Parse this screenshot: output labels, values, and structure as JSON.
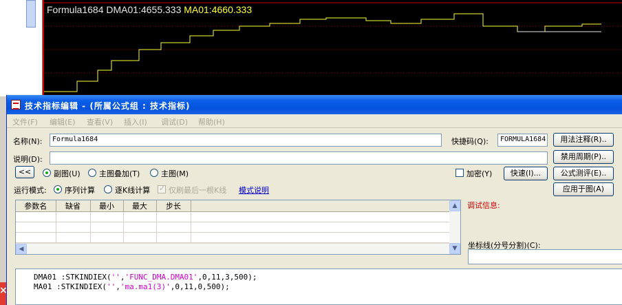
{
  "chart": {
    "label_formula": "Formula1684",
    "label_dma": "DMA01:4655.333",
    "label_ma": "MA01:4660.333",
    "colors": {
      "background": "#000000",
      "frame": "#cc0000",
      "ma_line": "#ffff33",
      "dma_line": "#e6e6e6"
    }
  },
  "window": {
    "title": "技术指标编辑 - (所属公式组 : 技术指标)",
    "menu": [
      "文件(F)",
      "编辑(E)",
      "查看(V)",
      "插入(I)",
      "调试(D)",
      "帮助(H)"
    ]
  },
  "form": {
    "name_label": "名称(N):",
    "name_value": "Formula1684",
    "shortcut_label": "快捷码(Q):",
    "shortcut_value": "FORMULA1684",
    "desc_label": "说明(D):",
    "desc_value": "",
    "collapse_button": "<<",
    "display_options": [
      "副图(U)",
      "主图叠加(T)",
      "主图(M)"
    ],
    "display_selected": "副图(U)",
    "encrypt_label": "加密(Y)",
    "fast_button": "快速(I)...",
    "mode_label": "运行模式:",
    "mode_options": [
      "序列计算",
      "逐K线计算"
    ],
    "mode_selected": "序列计算",
    "refresh_last_label": "仅刷最后一根K线",
    "mode_help_link": "模式说明"
  },
  "buttons": {
    "usage": "用法注释(R)..",
    "disabled_period": "禁用周期(P)..",
    "formula_eval": "公式测评(E)..",
    "apply_to_chart": "应用于图(A)"
  },
  "param_table": {
    "headers": [
      "参数名",
      "缺省",
      "最小",
      "最大",
      "步长"
    ]
  },
  "debug": {
    "label": "调试信息:",
    "axis_label": "坐标线(分号分割)(C):",
    "axis_value": ""
  },
  "editor": {
    "line1_a": "DMA01 :STKINDIEX(",
    "line1_s1": "''",
    "line1_b": ",",
    "line1_s2": "'FUNC_DMA.DMA01'",
    "line1_c": ",0,11,3,500);",
    "line2_a": "MA01 :STKINDIEX(",
    "line2_s1": "''",
    "line2_b": ",",
    "line2_s2": "'ma.ma1(3)'",
    "line2_c": ",0,11,0,500);"
  }
}
